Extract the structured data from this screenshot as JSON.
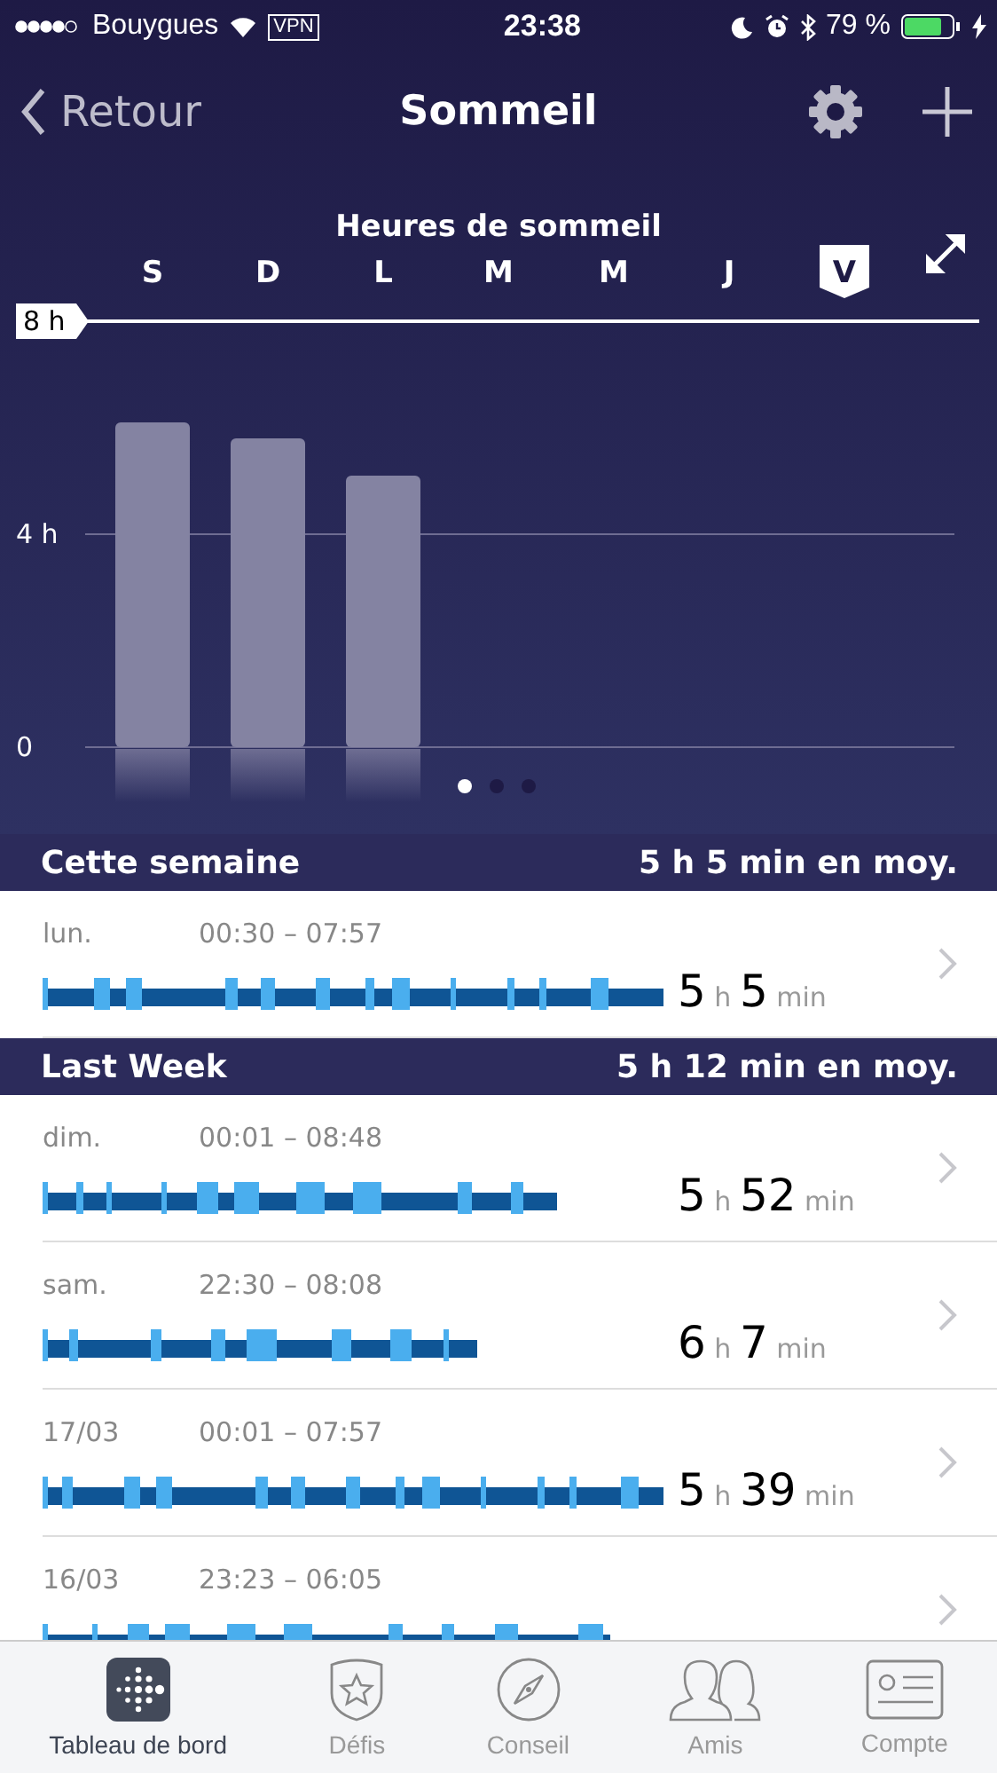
{
  "status_bar": {
    "carrier": "Bouygues",
    "vpn": "VPN",
    "time": "23:38",
    "battery": "79 %"
  },
  "nav": {
    "back": "Retour",
    "title": "Sommeil"
  },
  "chart": {
    "title": "Heures de sommeil",
    "day_tabs": [
      {
        "selected": false
      },
      {
        "selected": false
      },
      {
        "selected": false
      },
      {
        "selected": false
      },
      {
        "selected": false
      },
      {
        "selected": false
      },
      {
        "selected": true
      }
    ],
    "chart_data": {
      "type": "bar",
      "categories": [
        "S",
        "D",
        "L",
        "M",
        "M",
        "J",
        "V"
      ],
      "values": [
        6.1,
        5.8,
        5.1,
        null,
        null,
        null,
        null
      ],
      "ylim": [
        0,
        8
      ],
      "yticks": [
        {
          "value": 0,
          "label": "0"
        },
        {
          "value": 4,
          "label": "4 h"
        },
        {
          "value": 8,
          "label": "8 h"
        }
      ]
    },
    "pages": [
      {
        "selected": true
      },
      {
        "selected": false
      },
      {
        "selected": false
      }
    ]
  },
  "sections": [
    {
      "title": "Cette semaine",
      "average": "5 h 5 min en moy.",
      "rows": [
        {
          "day": "lun.",
          "times": "00:30 – 07:57",
          "hours": "5",
          "h": "h",
          "minutes": "5",
          "min": "min"
        }
      ]
    },
    {
      "title": "Last Week",
      "average": "5 h 12 min en moy.",
      "rows": [
        {
          "day": "dim.",
          "times": "00:01 – 08:48",
          "hours": "5",
          "h": "h",
          "minutes": "52",
          "min": "min"
        },
        {
          "day": "sam.",
          "times": "22:30 – 08:08",
          "hours": "6",
          "h": "h",
          "minutes": "7",
          "min": "min"
        },
        {
          "day": "17/03",
          "times": "00:01 – 07:57",
          "hours": "5",
          "h": "h",
          "minutes": "39",
          "min": "min"
        },
        {
          "day": "16/03",
          "times": "23:23 – 06:05"
        }
      ]
    }
  ],
  "tab_bar": [
    {
      "label": "Tableau de bord",
      "selected": true
    },
    {
      "label": "Défis",
      "selected": false
    },
    {
      "label": "Conseil",
      "selected": false
    },
    {
      "label": "Amis",
      "selected": false
    },
    {
      "label": "Compte",
      "selected": false
    }
  ]
}
